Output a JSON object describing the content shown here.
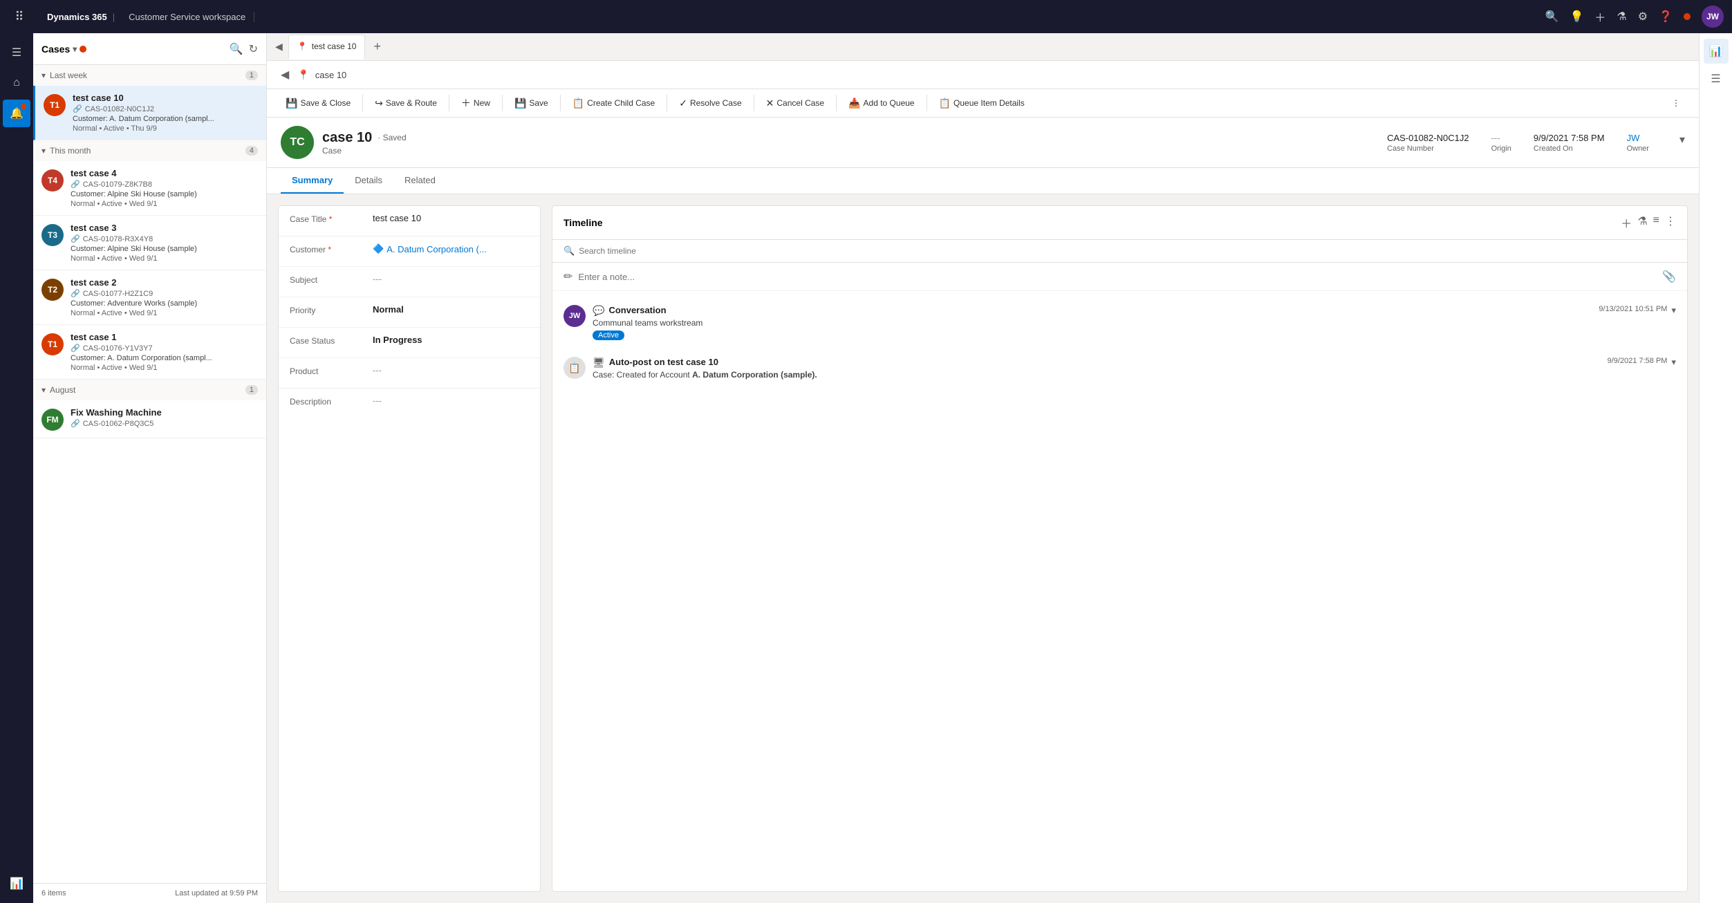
{
  "topbar": {
    "brand": "Dynamics 365",
    "separator": "|",
    "appname": "Customer Service workspace",
    "icons": [
      "search",
      "lightbulb",
      "plus",
      "filter",
      "settings",
      "help"
    ],
    "user_avatar": "JW",
    "user_dot_color": "#d83b01"
  },
  "sidebar": {
    "icons": [
      "grid",
      "home",
      "bell",
      "cases"
    ]
  },
  "case_list": {
    "title": "Cases",
    "footer_count": "6 items",
    "footer_updated": "Last updated at 9:59 PM",
    "groups": [
      {
        "label": "Last week",
        "count": "1",
        "expanded": true,
        "items": [
          {
            "id": "c1",
            "name": "test case 10",
            "case_number": "CAS-01082-N0C1J2",
            "customer": "Customer: A. Datum Corporation (sampl...",
            "meta": "Normal • Active • Thu 9/9",
            "avatar_initials": "T1",
            "avatar_color": "#d83b01",
            "active": true
          }
        ]
      },
      {
        "label": "This month",
        "count": "4",
        "expanded": true,
        "items": [
          {
            "id": "c2",
            "name": "test case 4",
            "case_number": "CAS-01079-Z8K7B8",
            "customer": "Customer: Alpine Ski House (sample)",
            "meta": "Normal • Active • Wed 9/1",
            "avatar_initials": "T4",
            "avatar_color": "#c0392b"
          },
          {
            "id": "c3",
            "name": "test case 3",
            "case_number": "CAS-01078-R3X4Y8",
            "customer": "Customer: Alpine Ski House (sample)",
            "meta": "Normal • Active • Wed 9/1",
            "avatar_initials": "T3",
            "avatar_color": "#1a6b8a"
          },
          {
            "id": "c4",
            "name": "test case 2",
            "case_number": "CAS-01077-H2Z1C9",
            "customer": "Customer: Adventure Works (sample)",
            "meta": "Normal • Active • Wed 9/1",
            "avatar_initials": "T2",
            "avatar_color": "#7b3f00"
          },
          {
            "id": "c5",
            "name": "test case 1",
            "case_number": "CAS-01076-Y1V3Y7",
            "customer": "Customer: A. Datum Corporation (sampl...",
            "meta": "Normal • Active • Wed 9/1",
            "avatar_initials": "T1",
            "avatar_color": "#d83b01"
          }
        ]
      },
      {
        "label": "August",
        "count": "1",
        "expanded": true,
        "items": [
          {
            "id": "c6",
            "name": "Fix Washing Machine",
            "case_number": "CAS-01062-P8Q3C5",
            "customer": "",
            "meta": "",
            "avatar_initials": "FM",
            "avatar_color": "#2e7d32"
          }
        ]
      }
    ]
  },
  "tabs": {
    "items": [
      {
        "label": "test case 10",
        "icon": "📋",
        "active": true
      }
    ],
    "add_label": "+"
  },
  "toolbar": {
    "save_close_label": "Save & Close",
    "save_route_label": "Save & Route",
    "new_label": "New",
    "save_label": "Save",
    "create_child_label": "Create Child Case",
    "resolve_label": "Resolve Case",
    "cancel_label": "Cancel Case",
    "add_queue_label": "Add to Queue",
    "queue_details_label": "Queue Item Details",
    "more_label": "⋮"
  },
  "record": {
    "avatar_initials": "TC",
    "avatar_color": "#2e7d32",
    "title": "case 10",
    "saved_indicator": "· Saved",
    "type": "Case",
    "case_number": "CAS-01082-N0C1J2",
    "case_number_label": "Case Number",
    "origin": "---",
    "origin_label": "Origin",
    "created_on": "9/9/2021 7:58 PM",
    "created_on_label": "Created On",
    "owner": "JW",
    "owner_label": "Owner",
    "tabs": [
      "Summary",
      "Details",
      "Related"
    ],
    "active_tab": "Summary",
    "form": {
      "case_title_label": "Case Title",
      "case_title_value": "test case 10",
      "customer_label": "Customer",
      "customer_value": "A. Datum Corporation (...",
      "customer_icon": "🔷",
      "subject_label": "Subject",
      "subject_value": "---",
      "priority_label": "Priority",
      "priority_value": "Normal",
      "case_status_label": "Case Status",
      "case_status_value": "In Progress",
      "product_label": "Product",
      "product_value": "---",
      "description_label": "Description",
      "description_value": "---"
    },
    "timeline": {
      "title": "Timeline",
      "search_placeholder": "Search timeline",
      "note_placeholder": "Enter a note...",
      "items": [
        {
          "type": "conversation",
          "avatar_initials": "JW",
          "avatar_color": "#5c2d91",
          "icon": "💬",
          "title": "Conversation",
          "description": "Communal teams workstream",
          "badge": "Active",
          "badge_color": "#0078d4",
          "time": "9/13/2021 10:51 PM",
          "expandable": true
        },
        {
          "type": "auto-post",
          "avatar_color": "#666",
          "icon": "📋",
          "title": "Auto-post on test case 10",
          "description": "Case: Created for Account A. Datum Corporation (sample).",
          "time": "9/9/2021 7:58 PM",
          "expandable": true
        }
      ]
    }
  }
}
